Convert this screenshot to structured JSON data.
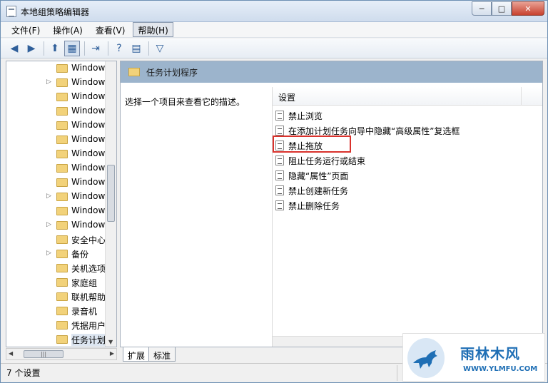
{
  "window": {
    "title": "本地组策略编辑器"
  },
  "menubar": [
    "文件(F)",
    "操作(A)",
    "查看(V)",
    "帮助(H)"
  ],
  "tree": [
    {
      "label": "Window",
      "arrow": false
    },
    {
      "label": "Window",
      "arrow": true
    },
    {
      "label": "Window",
      "arrow": false
    },
    {
      "label": "Window",
      "arrow": false
    },
    {
      "label": "Window",
      "arrow": false
    },
    {
      "label": "Window",
      "arrow": false
    },
    {
      "label": "Window",
      "arrow": false
    },
    {
      "label": "Window",
      "arrow": false
    },
    {
      "label": "Window",
      "arrow": false
    },
    {
      "label": "Window",
      "arrow": true
    },
    {
      "label": "Window",
      "arrow": false
    },
    {
      "label": "Window",
      "arrow": true
    },
    {
      "label": "安全中心",
      "arrow": false
    },
    {
      "label": "备份",
      "arrow": true
    },
    {
      "label": "关机选项",
      "arrow": false
    },
    {
      "label": "家庭组",
      "arrow": false
    },
    {
      "label": "联机帮助",
      "arrow": false
    },
    {
      "label": "录音机",
      "arrow": false
    },
    {
      "label": "凭据用户",
      "arrow": false
    },
    {
      "label": "任务计划",
      "arrow": false,
      "selected": true
    }
  ],
  "pane": {
    "header": "任务计划程序",
    "description": "选择一个项目来查看它的描述。",
    "column": "设置"
  },
  "settings": [
    "禁止浏览",
    "在添加计划任务向导中隐藏“高级属性”复选框",
    "禁止拖放",
    "阻止任务运行或结束",
    "隐藏“属性”页面",
    "禁止创建新任务",
    "禁止删除任务"
  ],
  "tabs": [
    "扩展",
    "标准"
  ],
  "status": "7 个设置",
  "watermark": {
    "title": "雨林木风",
    "url": "WWW.YLMFU.COM"
  },
  "colors": {
    "header_bg": "#9cb4cc",
    "highlight": "#d9322c"
  }
}
